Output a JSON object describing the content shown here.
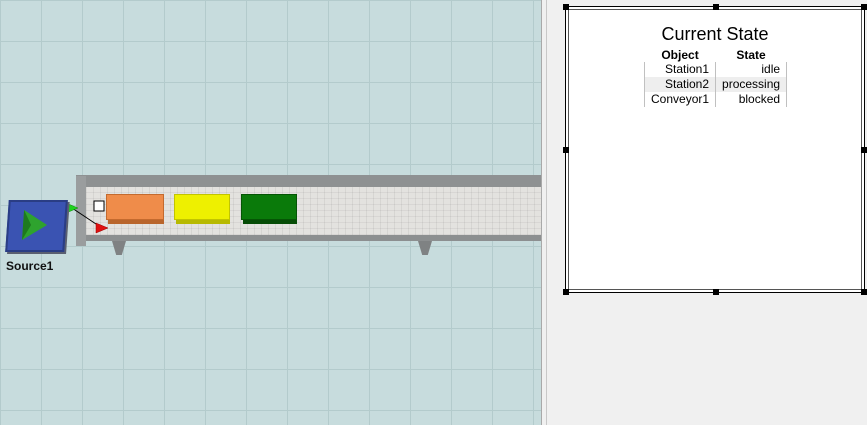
{
  "model_view": {
    "source_label": "Source1",
    "colors": {
      "floor": "#c7dcdd",
      "gridline": "#b3cbcc",
      "source": "#3a53b2",
      "box_orange": "#ef8c4a",
      "box_yellow": "#eef000",
      "box_green": "#0a7a0a"
    },
    "icons": [
      "play-triangle-icon",
      "output-port-arrow-icon",
      "input-port-arrow-icon"
    ],
    "boxes": [
      "orange",
      "yellow",
      "green"
    ]
  },
  "dashboard": {
    "title": "Current State",
    "columns": [
      "Object",
      "State"
    ],
    "rows": [
      {
        "object": "Station1",
        "state": "idle"
      },
      {
        "object": "Station2",
        "state": "processing"
      },
      {
        "object": "Conveyor1",
        "state": "blocked"
      }
    ]
  }
}
